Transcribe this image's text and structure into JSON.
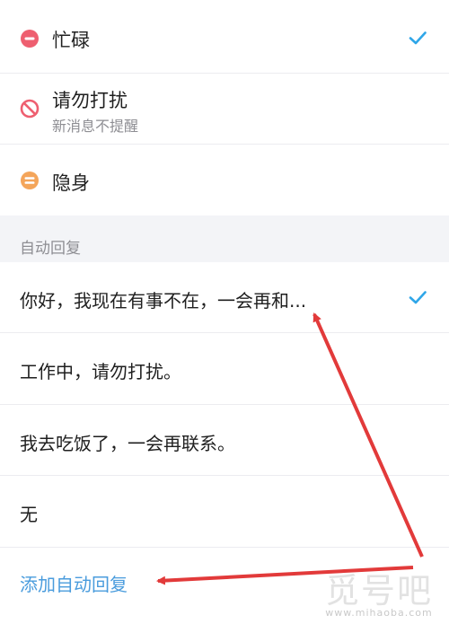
{
  "status_options": [
    {
      "label": "忙碌",
      "subtitle": "",
      "icon": "busy-minus-icon",
      "color": "#ee5f70",
      "selected": true
    },
    {
      "label": "请勿打扰",
      "subtitle": "新消息不提醒",
      "icon": "do-not-disturb-icon",
      "color": "#ee5f70",
      "selected": false
    },
    {
      "label": "隐身",
      "subtitle": "",
      "icon": "invisible-icon",
      "color": "#f4a55a",
      "selected": false
    }
  ],
  "auto_reply": {
    "section_title": "自动回复",
    "items": [
      {
        "text": "你好，我现在有事不在，一会再和...",
        "selected": true
      },
      {
        "text": "工作中，请勿打扰。",
        "selected": false
      },
      {
        "text": "我去吃饭了，一会再联系。",
        "selected": false
      },
      {
        "text": "无",
        "selected": false
      }
    ],
    "add_label": "添加自动回复"
  },
  "watermark": {
    "title": "觅号吧",
    "site": "www.mihaoba.com"
  },
  "colors": {
    "accent": "#4a9cdd",
    "check": "#2fa6e8",
    "arrow": "#e23a3a"
  }
}
